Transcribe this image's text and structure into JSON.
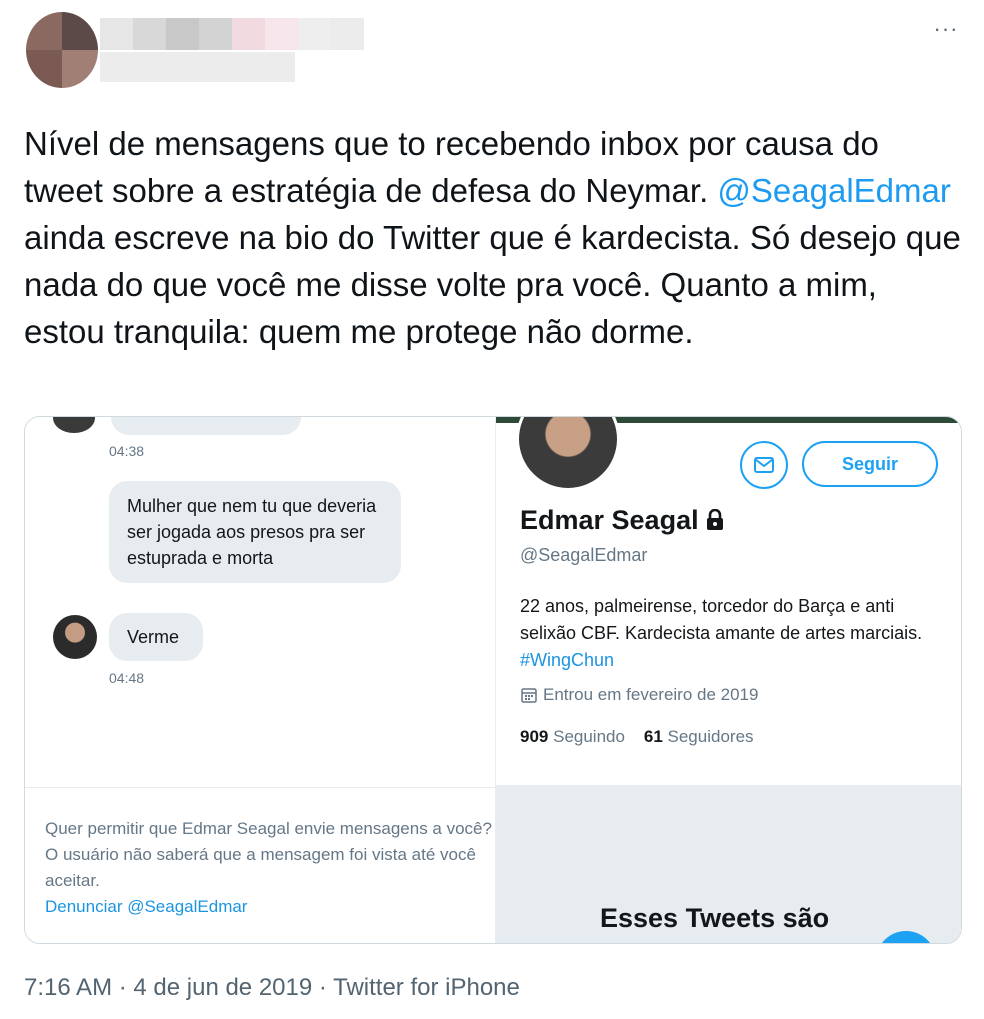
{
  "author": {
    "avatar": "blurred-avatar",
    "name_colors": [
      "#e6e6e6",
      "#d8d8d8",
      "#c8c8c8",
      "#d3d3d3",
      "#f1d9e0",
      "#f6e6ec",
      "#eeeeee",
      "#ebebeb"
    ]
  },
  "more_label": "···",
  "tweet": {
    "text_before": "Nível de mensagens que to recebendo inbox por causa do tweet sobre a estratégia de defesa do Neymar. ",
    "mention": "@SeagalEdmar",
    "text_after": " ainda escreve na bio do Twitter que é kardecista. Só desejo que nada do que você me disse volte pra você. Quanto a mim, estou tranquila: quem me protege não dorme."
  },
  "dm": {
    "time1": "04:38",
    "message1": "Mulher que nem tu que deveria ser jogada aos presos pra ser estuprada e morta",
    "message2": "Verme",
    "time2": "04:48",
    "request_text": "Quer permitir que Edmar Seagal envie mensagens a você? O usuário não saberá que a mensagem foi vista até você aceitar.",
    "report_link": "Denunciar @SeagalEdmar"
  },
  "profile": {
    "follow_label": "Seguir",
    "name": "Edmar Seagal",
    "handle": "@SeagalEdmar",
    "bio_text": "22 anos, palmeirense, torcedor do Barça e anti selixão CBF. Kardecista amante de artes marciais. ",
    "bio_hashtag": "#WingChun",
    "joined": "Entrou em fevereiro de 2019",
    "following_count": "909",
    "following_label": "Seguindo",
    "followers_count": "61",
    "followers_label": "Seguidores",
    "protected_heading": "Esses Tweets são"
  },
  "meta": {
    "text": "7:16 AM · 4 de jun de 2019 · Twitter for iPhone"
  },
  "colors": {
    "link_blue": "#1d9bf0",
    "bubble_grey": "#e6ecf0"
  }
}
